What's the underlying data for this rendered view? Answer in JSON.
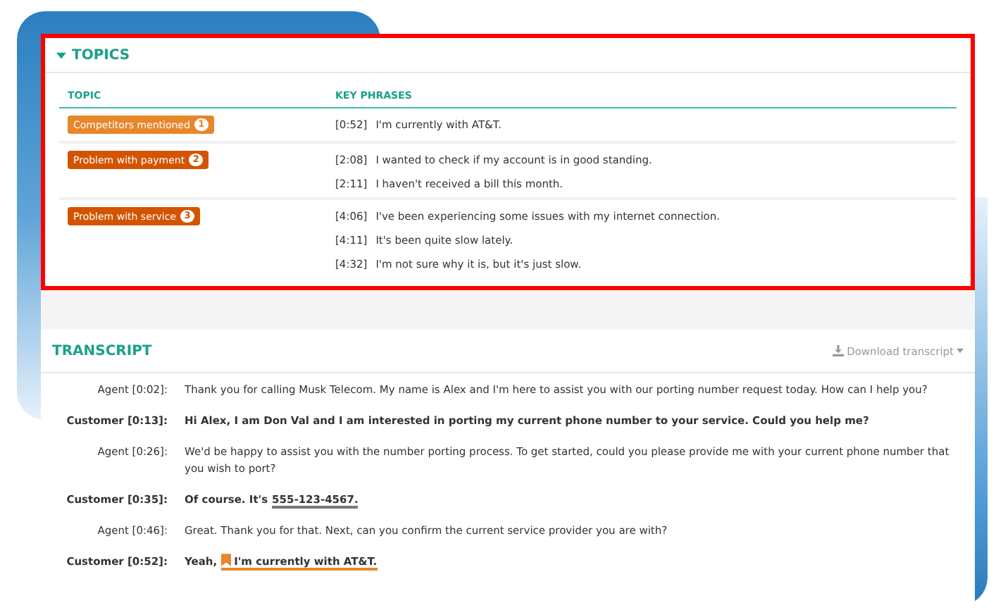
{
  "topics": {
    "title": "TOPICS",
    "expanded": true,
    "columns": [
      "TOPIC",
      "KEY PHRASES"
    ],
    "rows": [
      {
        "topic": "Competitors mentioned",
        "count": "1",
        "color": "#e8862a",
        "phrases": [
          {
            "time": "[0:52]",
            "text": "I'm currently with AT&T."
          }
        ]
      },
      {
        "topic": "Problem with payment",
        "count": "2",
        "color": "#d35400",
        "phrases": [
          {
            "time": "[2:08]",
            "text": "I wanted to check if my account is in good standing."
          },
          {
            "time": "[2:11]",
            "text": "I haven't received a bill this month."
          }
        ]
      },
      {
        "topic": "Problem with service",
        "count": "3",
        "color": "#d35400",
        "phrases": [
          {
            "time": "[4:06]",
            "text": "I've been experiencing some issues with my internet connection."
          },
          {
            "time": "[4:11]",
            "text": "It's been quite slow lately."
          },
          {
            "time": "[4:32]",
            "text": "I'm not sure why it is, but it's just slow."
          }
        ]
      }
    ]
  },
  "transcript": {
    "title": "TRANSCRIPT",
    "download": "Download transcript",
    "lines": [
      {
        "kind": "agent",
        "label": "Agent [0:02]:",
        "parts": [
          {
            "kind": "plain",
            "text": "Thank you for calling Musk Telecom. My name is Alex and I'm here to assist you with our porting number request today. How can I help you?"
          }
        ]
      },
      {
        "kind": "customer",
        "label": "Customer [0:13]:",
        "parts": [
          {
            "kind": "plain",
            "text": "Hi Alex, I am Don Val and I am interested in porting my current phone number to your service. Could you help me?"
          }
        ]
      },
      {
        "kind": "agent",
        "label": "Agent [0:26]:",
        "parts": [
          {
            "kind": "plain",
            "text": "We'd be happy to assist you with the number porting process. To get started, could you please provide me with your current phone number that you wish to port?"
          }
        ]
      },
      {
        "kind": "customer",
        "label": "Customer [0:35]:",
        "parts": [
          {
            "kind": "plain",
            "text": "Of course. It's"
          },
          {
            "kind": "entity",
            "text": "555-123-4567."
          }
        ]
      },
      {
        "kind": "agent",
        "label": "Agent [0:46]:",
        "parts": [
          {
            "kind": "plain",
            "text": "Great. Thank you for that. Next, can you confirm the current service provider you are with?"
          }
        ]
      },
      {
        "kind": "customer",
        "label": "Customer [0:52]:",
        "parts": [
          {
            "kind": "plain",
            "text": "Yeah,"
          },
          {
            "kind": "topic",
            "text": "I'm currently with AT&T."
          }
        ]
      }
    ]
  }
}
